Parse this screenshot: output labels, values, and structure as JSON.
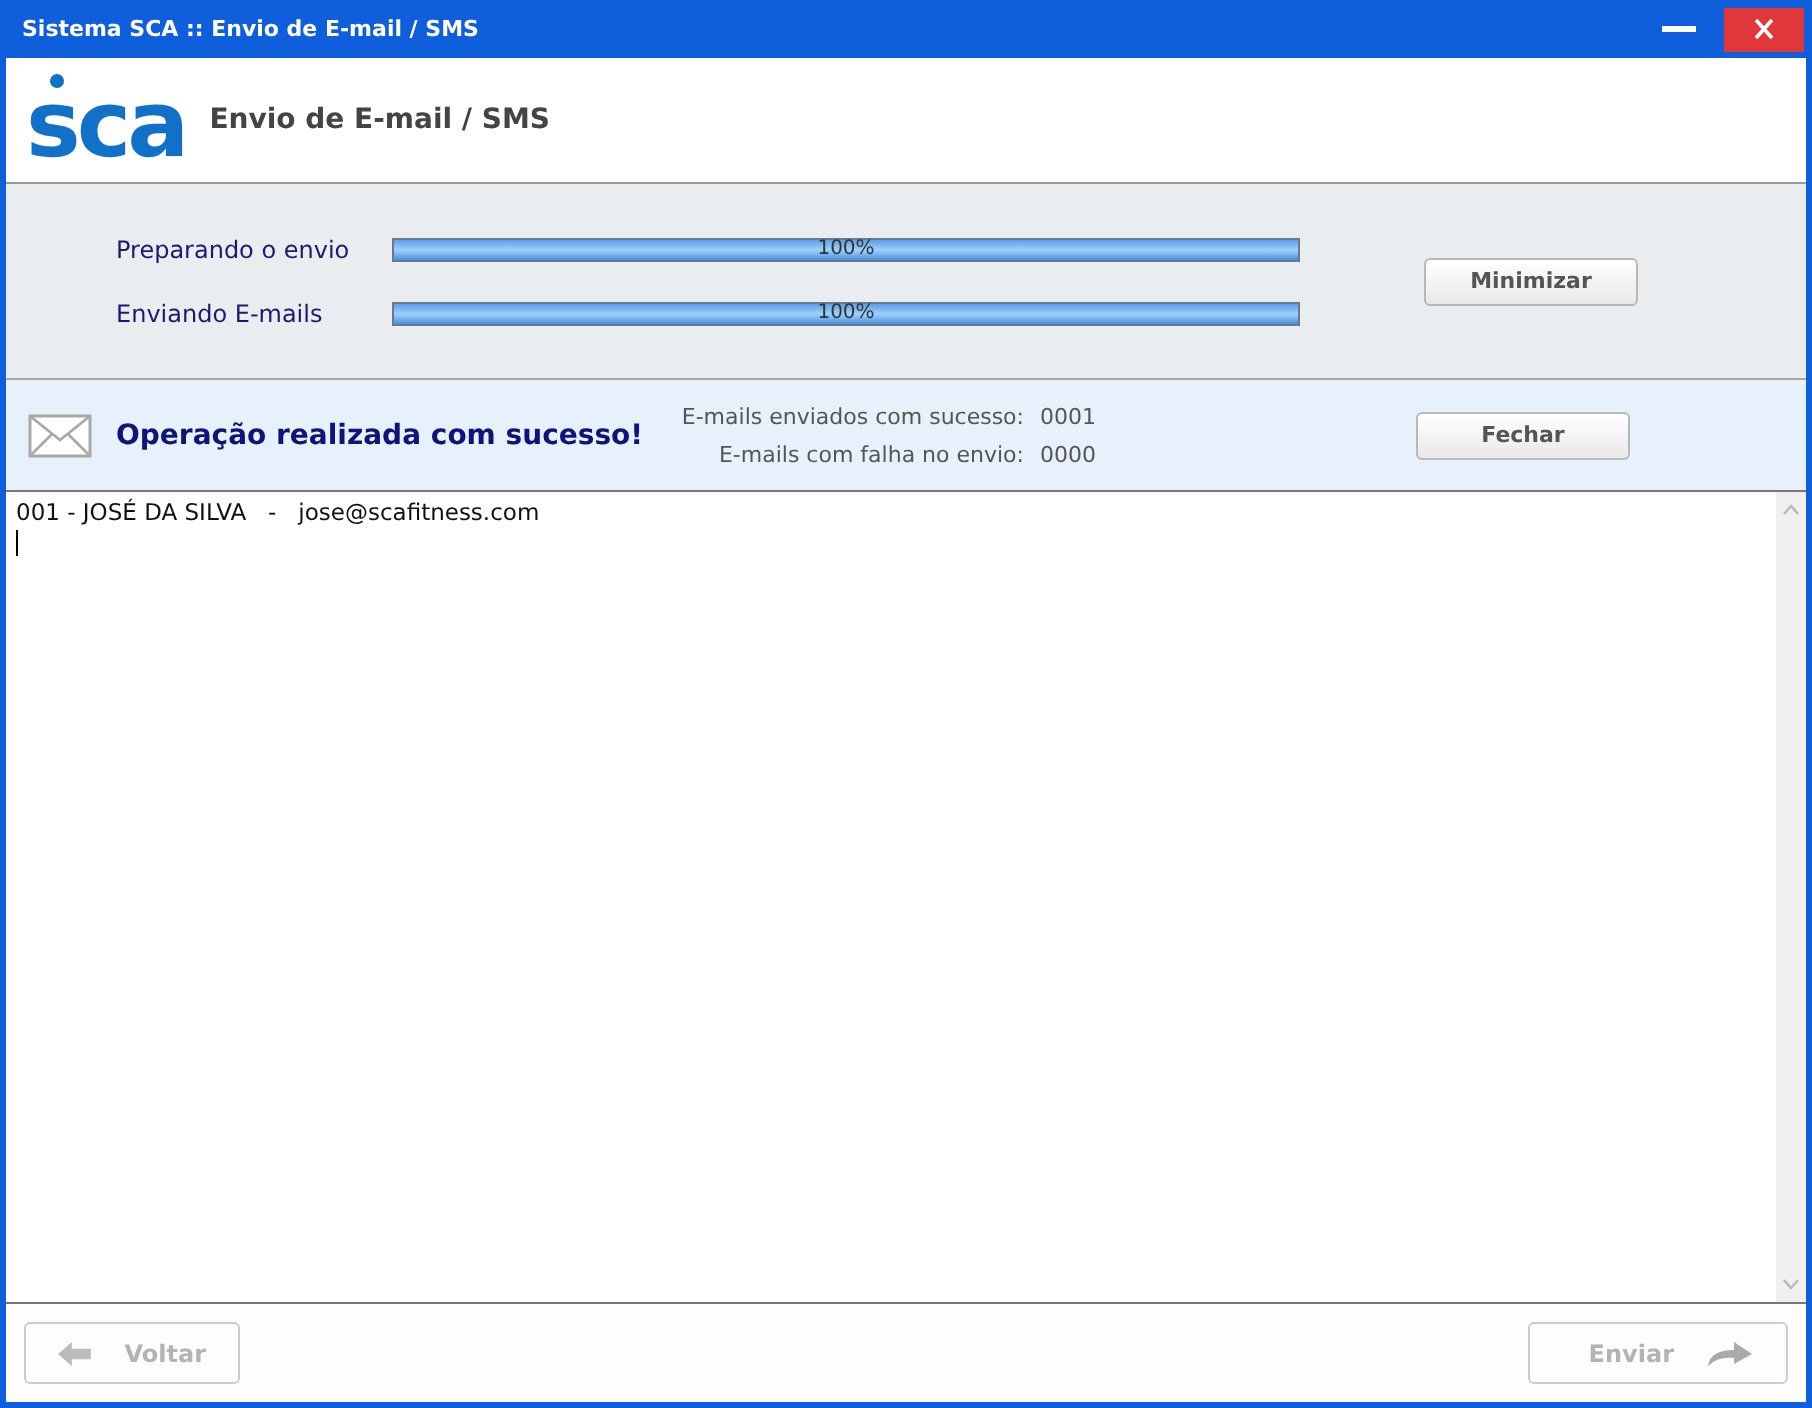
{
  "window": {
    "title": "Sistema SCA :: Envio de E-mail / SMS"
  },
  "header": {
    "logo": "sca",
    "title": "Envio de E-mail / SMS"
  },
  "progress": [
    {
      "label": "Preparando o envio",
      "level": 1,
      "reading": "100%"
    },
    {
      "label": "Enviando E-mails",
      "level": 1,
      "reading": "100%"
    }
  ],
  "minimize_button": "Minimizar",
  "status": {
    "message": "Operação realizada com sucesso!",
    "stats": [
      {
        "label": "E-mails enviados com sucesso:",
        "value": "0001"
      },
      {
        "label": "E-mails com falha no envio:",
        "value": "0000"
      }
    ],
    "close_button": "Fechar"
  },
  "log": {
    "lines": [
      "001 - JOSÉ DA SILVA   -   jose@scafitness.com"
    ]
  },
  "footer": {
    "back": {
      "label": "Voltar",
      "disabled": true
    },
    "send": {
      "label": "Enviar",
      "disabled": true
    }
  }
}
